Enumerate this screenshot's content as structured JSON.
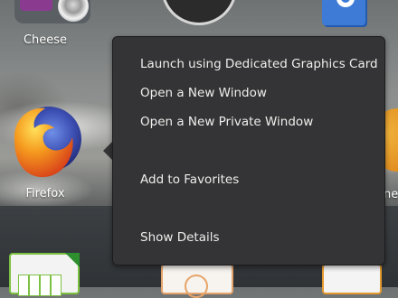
{
  "apps": {
    "cheese": {
      "label": "Cheese",
      "icon": "cheese-icon"
    },
    "clock": {
      "icon": "clock-icon"
    },
    "notes": {
      "icon": "notes-icon"
    },
    "firefox": {
      "label": "Firefox",
      "icon": "firefox-icon"
    },
    "partial_right": {
      "label": "ne"
    },
    "calc": {
      "icon": "calc-icon"
    },
    "impress": {
      "icon": "impress-icon"
    },
    "writer": {
      "icon": "writer-icon"
    }
  },
  "context_menu": {
    "items": [
      {
        "label": "Launch using Dedicated Graphics Card"
      },
      {
        "label": "Open a New Window"
      },
      {
        "label": "Open a New Private Window"
      },
      {
        "label": "Add to Favorites"
      },
      {
        "label": "Show Details"
      }
    ]
  },
  "colors": {
    "menu_bg": "#343436",
    "menu_text": "#eeeeec",
    "firefox_orange": "#f08c1f",
    "firefox_globe": "#3c4fb3"
  }
}
